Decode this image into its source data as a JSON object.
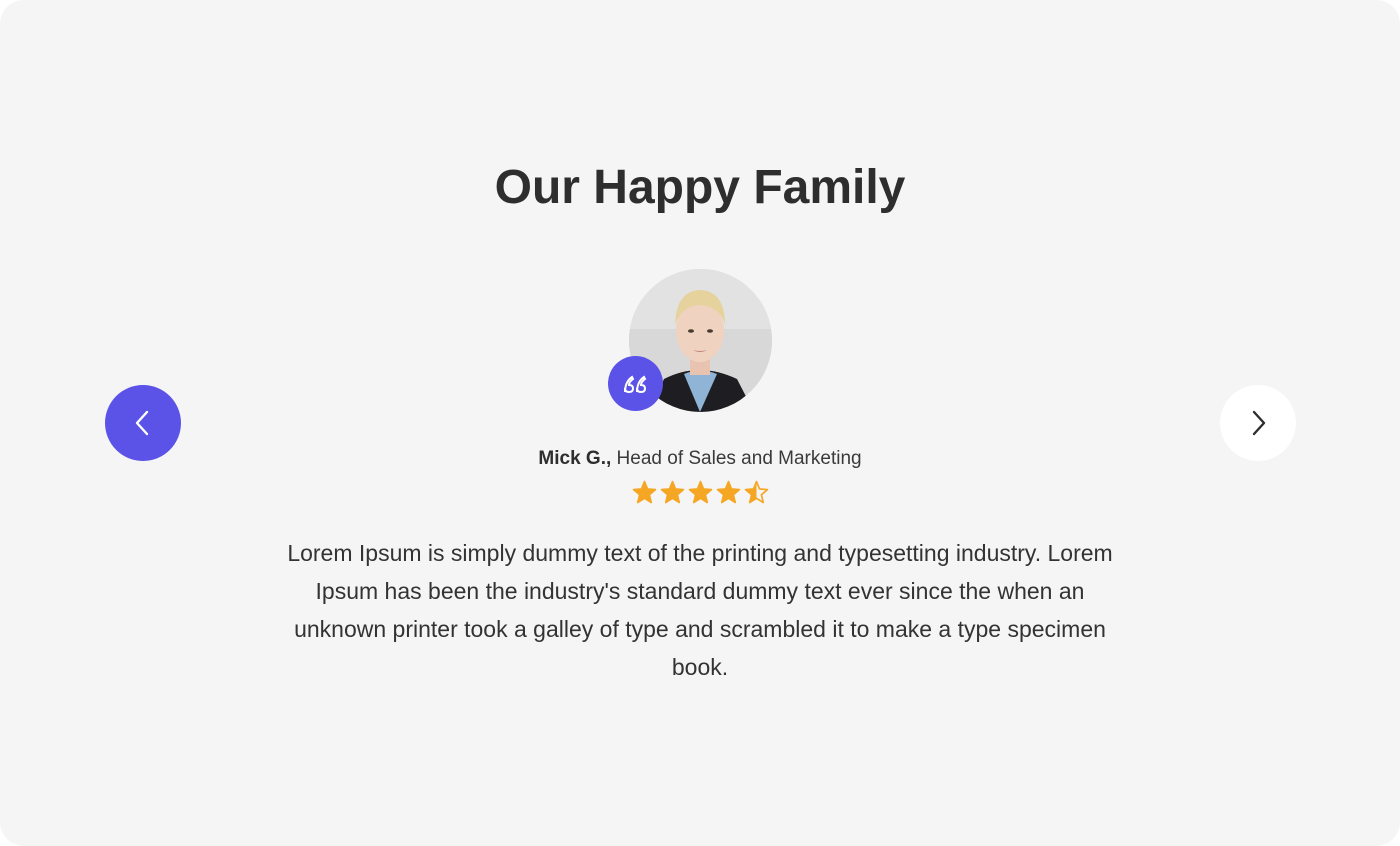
{
  "section": {
    "title": "Our Happy Family"
  },
  "testimonial": {
    "author_name": "Mick G.,",
    "author_role": "Head of Sales and Marketing",
    "rating": 4.5,
    "rating_max": 5,
    "quote": "Lorem Ipsum is simply dummy text of the printing and typesetting industry. Lorem Ipsum has been the industry's standard dummy text ever since the when an unknown printer took a galley of type and scrambled it to make a type specimen book."
  },
  "icons": {
    "prev": "chevron-left-icon",
    "next": "chevron-right-icon",
    "quote": "quote-icon",
    "star": "star-icon"
  },
  "colors": {
    "accent": "#5b53e8",
    "star": "#f5a623",
    "background": "#f5f5f5",
    "text": "#2e2e2e"
  }
}
